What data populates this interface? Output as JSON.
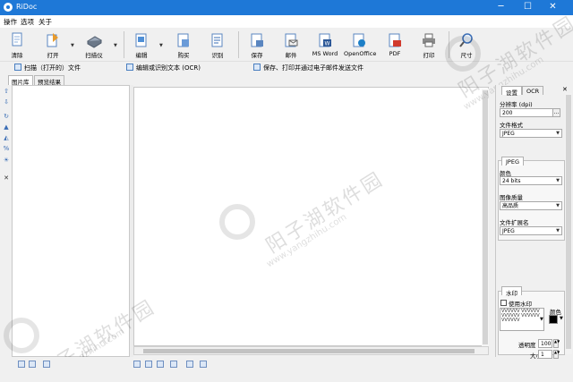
{
  "window": {
    "title": "RiDoc",
    "minimize": "─",
    "maximize": "☐",
    "close": "✕"
  },
  "menu": [
    "操作",
    "选项",
    "关于"
  ],
  "toolbar": {
    "buttons": [
      {
        "label": "清除",
        "icon": "clear-icon"
      },
      {
        "label": "打开",
        "icon": "open-icon"
      },
      {
        "label": "扫描仪",
        "icon": "scanner-icon"
      },
      {
        "label": "编辑",
        "icon": "edit-icon"
      },
      {
        "label": "购买",
        "icon": "buy-icon"
      },
      {
        "label": "识别",
        "icon": "recognize-icon"
      },
      {
        "label": "保存",
        "icon": "save-icon"
      },
      {
        "label": "邮件",
        "icon": "mail-icon"
      },
      {
        "label": "MS Word",
        "icon": "word-icon"
      },
      {
        "label": "OpenOffice",
        "icon": "openoffice-icon"
      },
      {
        "label": "PDF",
        "icon": "pdf-icon"
      },
      {
        "label": "打印",
        "icon": "print-icon"
      },
      {
        "label": "尺寸",
        "icon": "size-icon"
      }
    ]
  },
  "quicklinks": [
    "扫描（打开的）文件",
    "编辑或识别文本 (OCR)",
    "保存、打印并通过电子邮件发送文件"
  ],
  "left_tabs": [
    "图片库",
    "预览结果"
  ],
  "right_panel": {
    "tabs": [
      "设置",
      "OCR"
    ],
    "resolution_label": "分辨率 (dpi)",
    "resolution_value": "200",
    "format_label": "文件格式",
    "format_value": "JPEG",
    "jpeg_tab": "JPEG",
    "color_label": "颜色",
    "color_value": "24 bits",
    "quality_label": "图像质量",
    "quality_value": "高品质",
    "ext_label": "文件扩展名",
    "ext_value": "JPEG",
    "watermark_tab": "水印",
    "use_watermark": "使用水印",
    "wm_color_label": "颜色",
    "wm_preview": "VVVVVV VVVVVV VVVVVV VVVVVV VVVVVV",
    "transparency_label": "透明度",
    "transparency_value": "100",
    "size_label": "大小",
    "size_value": "1"
  },
  "watermark_texts": {
    "cn": "阳子湖软件园",
    "url": "www.yangzhihu.com"
  },
  "colors": {
    "titlebar": "#1e78d7",
    "accent": "#3a6db5"
  }
}
